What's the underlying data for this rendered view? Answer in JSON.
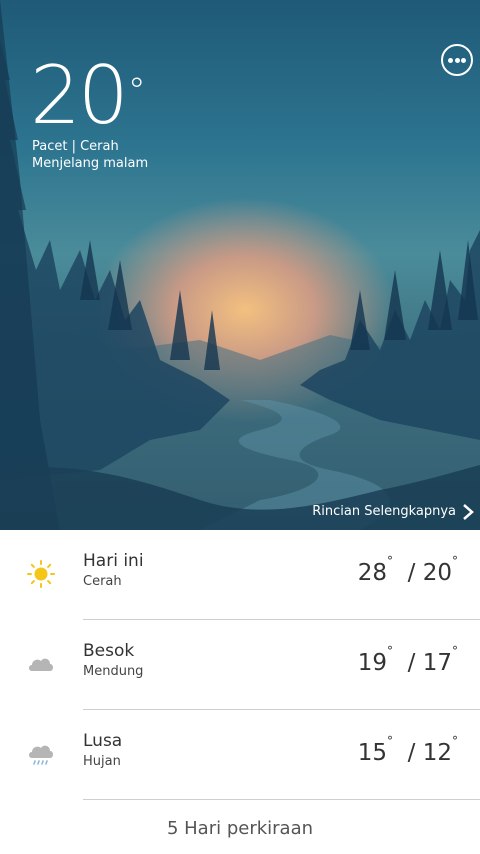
{
  "weather": {
    "temperature": "20",
    "degree_symbol": "°",
    "location_condition": "Pacet | Cerah",
    "time_of_day": "Menjelang malam",
    "detail_link": "Rincian Selengkapnya"
  },
  "forecast": [
    {
      "day": "Hari ini",
      "condition": "Cerah",
      "high": "28",
      "low": "20",
      "icon": "sun-icon"
    },
    {
      "day": "Besok",
      "condition": "Mendung",
      "high": "19",
      "low": "17",
      "icon": "cloud-icon"
    },
    {
      "day": "Lusa",
      "condition": "Hujan",
      "high": "15",
      "low": "12",
      "icon": "rain-cloud-icon"
    }
  ],
  "forecast_button": "5 Hari perkiraan",
  "colors": {
    "sun": "#f5c518",
    "cloud": "#b5b5b5",
    "rain": "#8fb8d8"
  }
}
